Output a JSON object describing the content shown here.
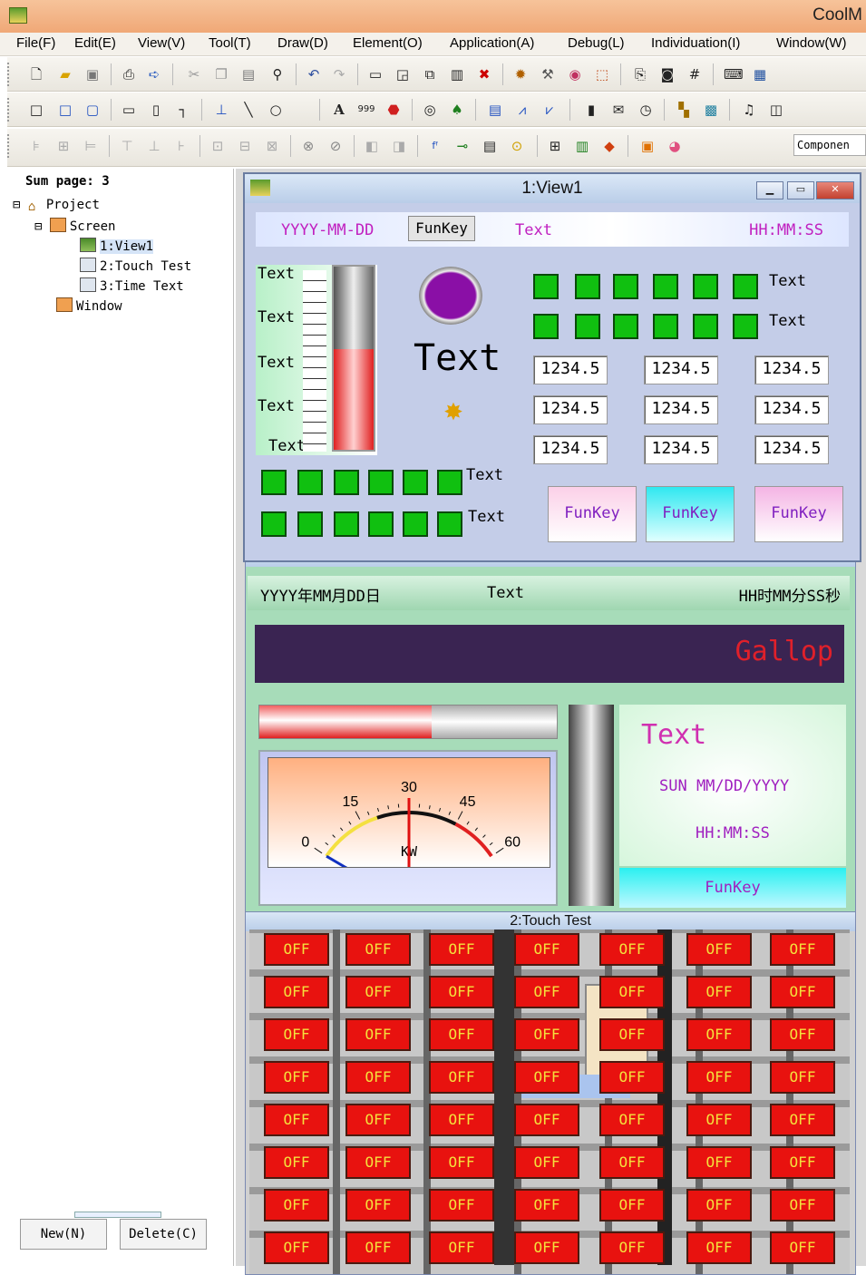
{
  "app": {
    "title": "CoolM"
  },
  "menu": [
    "File(F)",
    "Edit(E)",
    "View(V)",
    "Tool(T)",
    "Draw(D)",
    "Element(O)",
    "Application(A)",
    "Debug(L)",
    "Individuation(I)",
    "Window(W)"
  ],
  "toolbar3": {
    "component_label": "Componen"
  },
  "project_tree": {
    "sum_page": "Sum page: 3",
    "project": "Project",
    "screen": "Screen",
    "pages": [
      "1:View1",
      "2:Touch Test",
      "3:Time Text"
    ],
    "window": "Window"
  },
  "buttons": {
    "new": "New(N)",
    "delete": "Delete(C)"
  },
  "view1": {
    "title": "1:View1",
    "date_format": "YYYY-MM-DD",
    "funkey_top": "FunKey",
    "header_text": "Text",
    "time_format": "HH:MM:SS",
    "thermo_labels": [
      "Text",
      "Text",
      "Text",
      "Text",
      "Text"
    ],
    "thermo_fill": 0.55,
    "big_text": "Text",
    "square_row_labels": [
      "Text",
      "Text"
    ],
    "numbers": [
      "1234.5",
      "1234.5",
      "1234.5",
      "1234.5",
      "1234.5",
      "1234.5",
      "1234.5",
      "1234.5",
      "1234.5"
    ],
    "bottom_square_labels": [
      "Text",
      "Text"
    ],
    "funkeys": [
      "FunKey",
      "FunKey",
      "FunKey"
    ],
    "colors": {
      "indicator": "#8a0fa6",
      "square": "#10c010",
      "panel": "#c4cde8"
    }
  },
  "time_text": {
    "title": "3:Time Text",
    "date_format": "YYYY年MM月DD日",
    "center_text": "Text",
    "time_format": "HH时MM分SS秒",
    "marquee": "Gallop",
    "progress_fill": 0.58,
    "gauge": {
      "ticks": [
        "0",
        "15",
        "30",
        "45",
        "60"
      ],
      "unit": "KW",
      "value": 30
    },
    "side_text": "Text",
    "side_date": "SUN MM/DD/YYYY",
    "side_time": "HH:MM:SS",
    "side_funkey": "FunKey"
  },
  "touch_test": {
    "title": "2:Touch Test",
    "off_label": "OFF"
  }
}
